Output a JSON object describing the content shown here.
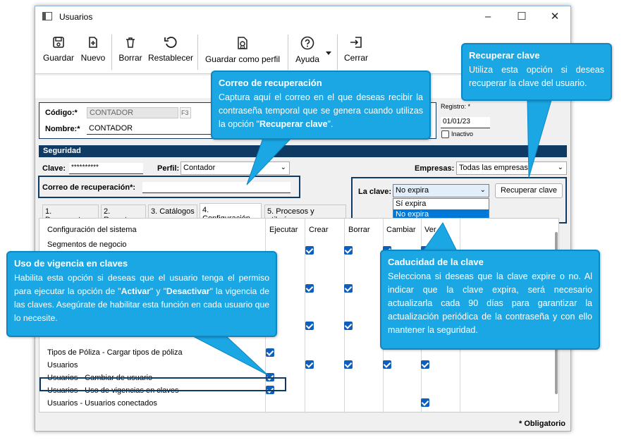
{
  "window": {
    "title": "Usuarios"
  },
  "toolbar": {
    "guardar": "Guardar",
    "nuevo": "Nuevo",
    "borrar": "Borrar",
    "restablecer": "Restablecer",
    "guardar_perfil": "Guardar como perfil",
    "ayuda": "Ayuda",
    "cerrar": "Cerrar"
  },
  "form": {
    "codigo_label": "Código:*",
    "codigo_value": "CONTADOR",
    "codigo_key": "F3",
    "nombre_label": "Nombre:*",
    "nombre_value": "CONTADOR",
    "registro_label": "Registro: *",
    "registro_value": "01/01/23",
    "inactivo_label": "Inactivo"
  },
  "seguridad": {
    "title": "Seguridad",
    "clave_label": "Clave:",
    "clave_value": "**********",
    "perfil_label": "Perfil:",
    "perfil_value": "Contador",
    "empresas_label": "Empresas:",
    "empresas_value": "Todas las empresas",
    "correo_label": "Correo de recuperación*:",
    "correo_value": "",
    "la_clave_label": "La clave:",
    "la_clave_value": "No expira",
    "la_clave_options": [
      "Sí expira",
      "No expira"
    ],
    "recuperar_button": "Recuperar clave"
  },
  "tabs": [
    "1. Documentos",
    "2. Reportes",
    "3. Catálogos",
    "4. Configuración",
    "5. Procesos y utilerías"
  ],
  "grid": {
    "headers": [
      "Configuración del sistema",
      "Ejecutar",
      "Crear",
      "Borrar",
      "Cambiar",
      "Ver"
    ],
    "rows": [
      {
        "label": "Segmentos de negocio"
      },
      {
        "label": "Tipos de Póliza - Cargar tipos de póliza"
      },
      {
        "label": "Usuarios"
      },
      {
        "label": "Usuarios - Cambiar de usuario"
      },
      {
        "label": "Usuarios - Uso de vigencias en claves"
      },
      {
        "label": "Usuarios - Usuarios conectados"
      }
    ],
    "footer": "* Obligatorio"
  },
  "callouts": {
    "recuperar": {
      "title": "Recuperar clave",
      "body": "Utiliza esta opción si deseas recuperar la clave del usuario."
    },
    "correo": {
      "title": "Correo de recuperación",
      "body_pre": "Captura aquí el correo en el que deseas recibir la contraseña temporal que se genera cuando utilizas la opción \"",
      "body_bold": "Recuperar clave",
      "body_post": "\"."
    },
    "vigencia": {
      "title": "Uso de vigencia en claves",
      "body_pre": "Habilita esta opción si deseas que el usuario tenga el permiso para ejecutar la opción de \"",
      "bold1": "Activar",
      "mid": "\" y \"",
      "bold2": "Desactivar",
      "body_post": "\" la vigencia de las claves. Asegúrate de habilitar esta función en cada usuario que lo necesite."
    },
    "caducidad": {
      "title": "Caducidad de la clave",
      "body": "Selecciona si deseas que la clave expire o no. Al indicar que la clave expira, será necesario actualizarla cada 90 días para garantizar la actualización periódica de la contraseña y con ello mantener la seguridad."
    }
  },
  "colors": {
    "accent": "#1aa7e4",
    "frame": "#0f3a64",
    "check": "#0e5fbd"
  }
}
